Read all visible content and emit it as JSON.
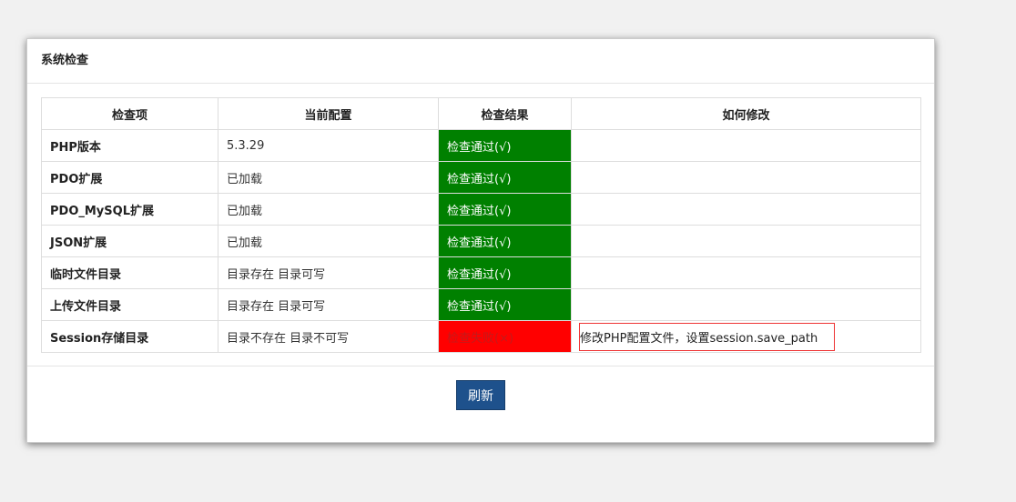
{
  "title": "系统检查",
  "headers": [
    "检查项",
    "当前配置",
    "检查结果",
    "如何修改"
  ],
  "rows": [
    {
      "item": "PHP版本",
      "config": "5.3.29",
      "result": "检查通过(√)",
      "status": "ok",
      "fix": ""
    },
    {
      "item": "PDO扩展",
      "config": "已加载",
      "result": "检查通过(√)",
      "status": "ok",
      "fix": ""
    },
    {
      "item": "PDO_MySQL扩展",
      "config": "已加载",
      "result": "检查通过(√)",
      "status": "ok",
      "fix": ""
    },
    {
      "item": "JSON扩展",
      "config": "已加载",
      "result": "检查通过(√)",
      "status": "ok",
      "fix": ""
    },
    {
      "item": "临时文件目录",
      "config": "目录存在 目录可写",
      "result": "检查通过(√)",
      "status": "ok",
      "fix": ""
    },
    {
      "item": "上传文件目录",
      "config": "目录存在 目录可写",
      "result": "检查通过(√)",
      "status": "ok",
      "fix": ""
    },
    {
      "item": "Session存储目录",
      "config": "目录不存在 目录不可写",
      "result": "检查失败(×)",
      "status": "fail",
      "fix": "修改PHP配置文件，设置session.save_path"
    }
  ],
  "refresh_label": "刷新",
  "colors": {
    "pass": "#008000",
    "fail": "#ff0000",
    "button": "#1e518c"
  }
}
